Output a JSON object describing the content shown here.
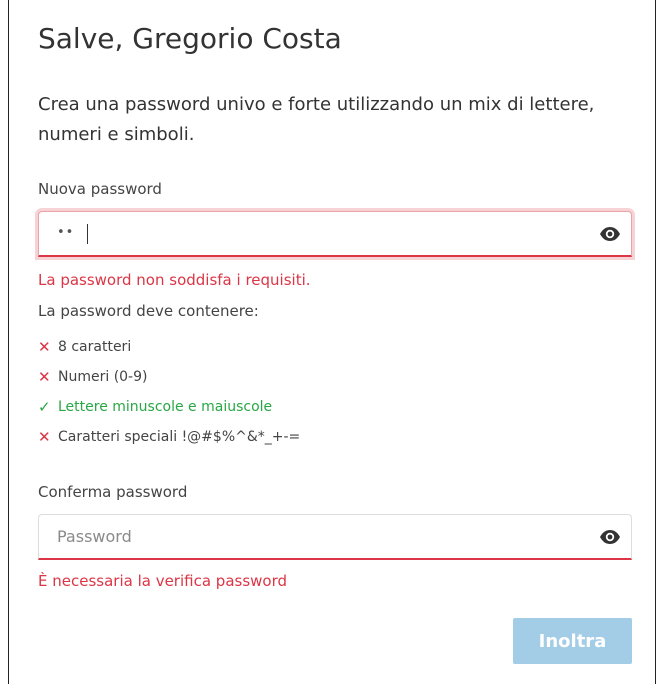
{
  "header": {
    "title": "Salve, Gregorio Costa",
    "intro": "Crea una password univo e forte utilizzando un mix di lettere, numeri e simboli."
  },
  "new_password": {
    "label": "Nuova password",
    "masked_value": "••",
    "show_icon": "eye-icon",
    "error": "La password non soddisfa i requisiti.",
    "state": "invalid"
  },
  "requirements": {
    "heading": "La password deve contenere:",
    "items": [
      {
        "label": "8 caratteri",
        "status": "fail",
        "mark": "✕"
      },
      {
        "label": "Numeri (0-9)",
        "status": "fail",
        "mark": "✕"
      },
      {
        "label": "Lettere minuscole e maiuscole",
        "status": "pass",
        "mark": "✓"
      },
      {
        "label": "Caratteri speciali !@#$%^&*_+-=",
        "status": "fail",
        "mark": "✕"
      }
    ]
  },
  "confirm_password": {
    "label": "Conferma password",
    "value": "",
    "placeholder": "Password",
    "show_icon": "eye-icon",
    "error": "È necessaria la verifica password",
    "state": "invalid"
  },
  "actions": {
    "submit_label": "Inoltra",
    "submit_state": "disabled"
  },
  "colors": {
    "error": "#dc3545",
    "success": "#28a745",
    "button_disabled": "#a3cce6",
    "text": "#333333"
  }
}
